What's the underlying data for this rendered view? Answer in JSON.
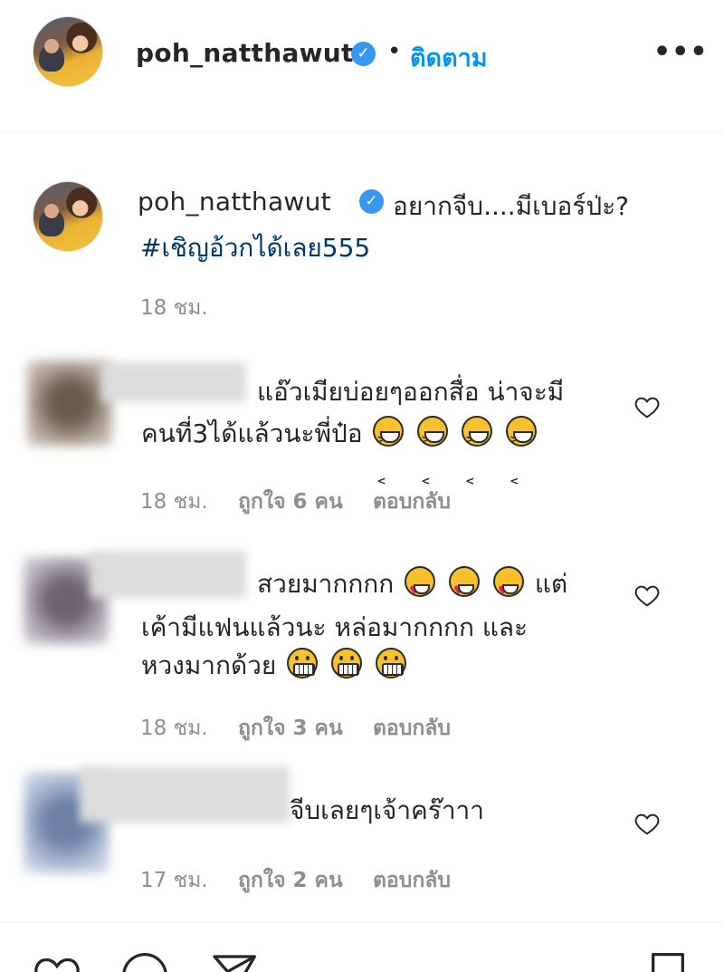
{
  "header": {
    "username": "poh_natthawut",
    "verified_glyph": "✓",
    "separator": "•",
    "follow_label": "ติดตาม",
    "more_label": "•••"
  },
  "post": {
    "username": "poh_natthawut",
    "verified_glyph": "✓",
    "caption": "อยากจีบ....มีเบอร์ป่ะ?",
    "hashtag": "#เชิญอ้วกได้เลย555",
    "time": "18 ชม."
  },
  "comments": [
    {
      "line1": "แอ๊วเมียบ่อยๆออกสื่อ น่าจะมี",
      "line2": "คนที่3ได้แล้วนะพี่ป๋อ",
      "emojis": [
        "laugh",
        "laugh",
        "laugh",
        "laugh"
      ],
      "time": "18 ชม.",
      "likes": "ถูกใจ 6 คน",
      "reply": "ตอบกลับ",
      "avatar_color": "#8a7a6c"
    },
    {
      "line1": "สวยมากกกก",
      "line1_tail": "แต่",
      "line2": "เค้ามีแฟนแล้วนะ หล่อมากกกก และ",
      "line3": "หวงมากด้วย",
      "emojis": [
        "love",
        "love",
        "love"
      ],
      "emojis_line3": [
        "grin",
        "grin",
        "grin"
      ],
      "time": "18 ชม.",
      "likes": "ถูกใจ 3 คน",
      "reply": "ตอบกลับ",
      "avatar_color": "#8c8090"
    },
    {
      "line1": "จีบเลยๆเจ้าคร๊าาา",
      "time": "17 ชม.",
      "likes": "ถูกใจ 2 คน",
      "reply": "ตอบกลับ",
      "avatar_color": "#7f93b5"
    }
  ],
  "icons": {
    "verified": "verified-badge-icon",
    "heart": "heart-outline-icon",
    "comment": "comment-bubble-icon",
    "share": "paper-plane-icon",
    "save": "bookmark-icon"
  },
  "colors": {
    "link": "#0095f6",
    "hashtag": "#00376b",
    "muted": "#8e8e8e",
    "verified": "#3897f0"
  }
}
